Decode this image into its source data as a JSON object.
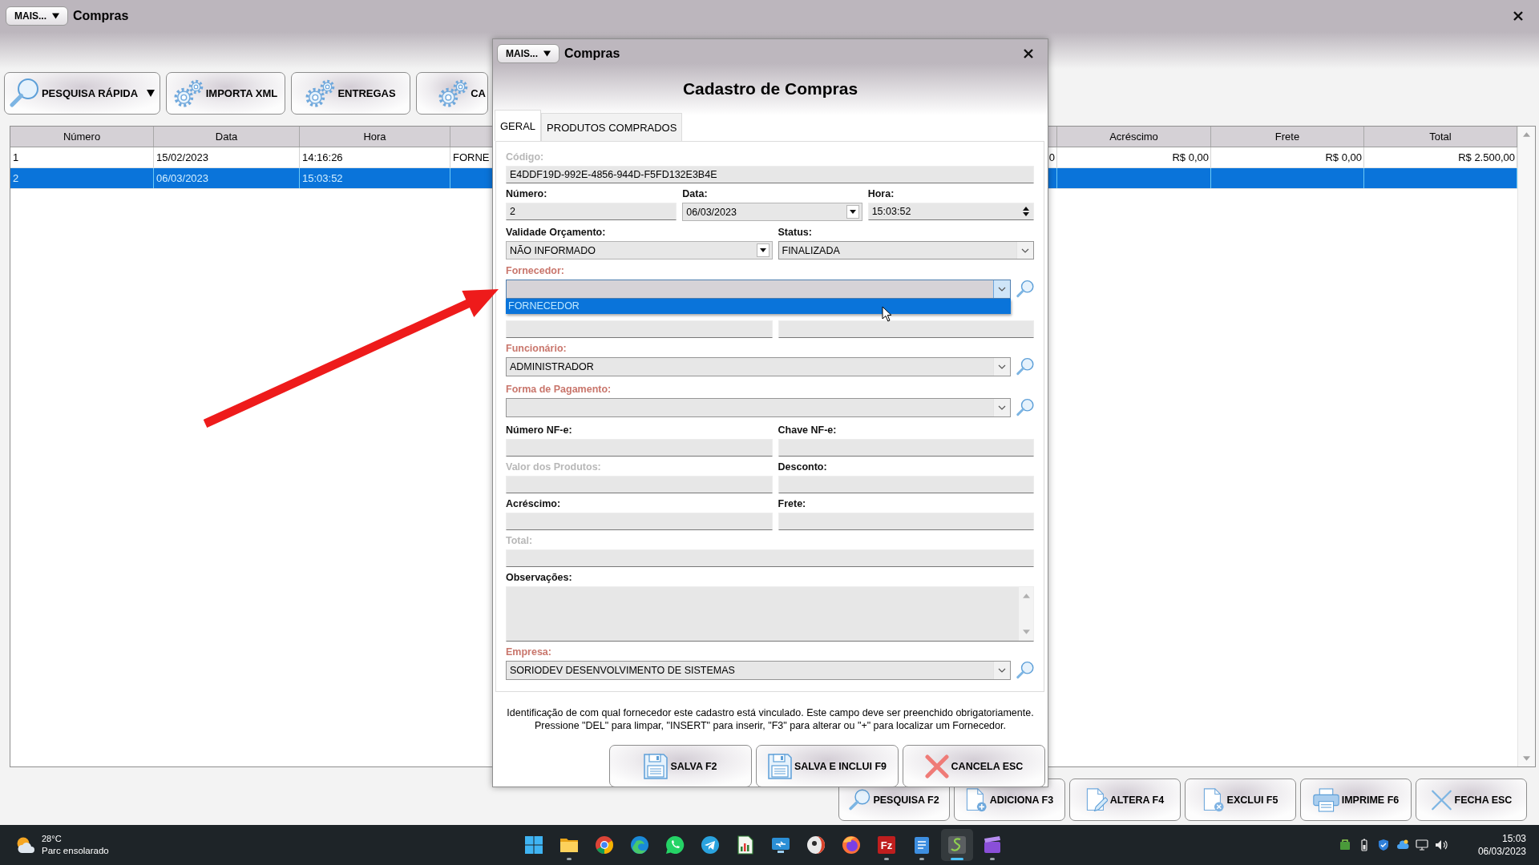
{
  "window": {
    "menu_button": "MAIS...",
    "title": "Compras"
  },
  "toolbar": [
    {
      "label": "PESQUISA RÁPIDA",
      "kind": "search",
      "dropdown": true
    },
    {
      "label": "IMPORTA XML",
      "kind": "gears",
      "dropdown": false
    },
    {
      "label": "ENTREGAS",
      "kind": "gears",
      "dropdown": false
    },
    {
      "label": "CA",
      "kind": "gears",
      "dropdown": false
    }
  ],
  "table": {
    "columns": [
      "Número",
      "Data",
      "Hora",
      "Acréscimo",
      "Frete",
      "Total"
    ],
    "rows": [
      {
        "selected": false,
        "cells": [
          "1",
          "15/02/2023",
          "14:16:26",
          "FORNE",
          "0",
          "R$ 0,00",
          "R$ 0,00",
          "R$ 2.500,00"
        ]
      },
      {
        "selected": true,
        "cells": [
          "2",
          "06/03/2023",
          "15:03:52"
        ]
      }
    ]
  },
  "dialog": {
    "menu_button": "MAIS...",
    "title": "Compras",
    "heading": "Cadastro de Compras",
    "tabs": [
      {
        "label": "GERAL",
        "selected": true
      },
      {
        "label": "PRODUTOS COMPRADOS",
        "selected": false
      }
    ],
    "form": [
      {
        "fields": [
          {
            "kind": "text",
            "label": "Código:",
            "value": "E4DDF19D-992E-4856-944D-F5FD132E3B4E",
            "required": false,
            "disabled": true
          }
        ]
      },
      {
        "fields": [
          {
            "kind": "text",
            "label": "Número:",
            "value": "2",
            "required": false,
            "disabled": false
          },
          {
            "kind": "picker",
            "label": "Data:",
            "value": "06/03/2023",
            "required": false,
            "disabled": false
          },
          {
            "kind": "spin",
            "label": "Hora:",
            "value": "15:03:52",
            "required": false,
            "disabled": false
          }
        ]
      },
      {
        "fields": [
          {
            "kind": "picker",
            "label": "Validade Orçamento:",
            "value": "NÃO INFORMADO",
            "required": false,
            "disabled": false
          },
          {
            "kind": "combo",
            "label": "Status:",
            "value": "FINALIZADA",
            "required": false,
            "disabled": false,
            "search": false,
            "open": false
          }
        ]
      },
      {
        "fields": [
          {
            "kind": "combo",
            "label": "Fornecedor:",
            "required": true,
            "disabled": false,
            "search": true,
            "open": true,
            "options": [
              {
                "label": "FORNECEDOR",
                "selected": true
              }
            ]
          }
        ]
      },
      {
        "fields": [
          {
            "kind": "text"
          },
          {
            "kind": "text"
          }
        ]
      },
      {
        "fields": [
          {
            "kind": "combo",
            "label": "Funcionário:",
            "value": "ADMINISTRADOR",
            "required": true,
            "disabled": false,
            "search": true,
            "open": false
          }
        ]
      },
      {
        "fields": [
          {
            "kind": "combo",
            "label": "Forma de Pagamento:",
            "required": true,
            "disabled": false,
            "search": true,
            "open": false
          }
        ]
      },
      {
        "fields": [
          {
            "kind": "text",
            "label": "Número NF-e:",
            "required": false,
            "disabled": false
          },
          {
            "kind": "text",
            "label": "Chave NF-e:",
            "required": false,
            "disabled": false
          }
        ]
      },
      {
        "fields": [
          {
            "kind": "text",
            "label": "Valor dos Produtos:",
            "required": false,
            "disabled": true
          },
          {
            "kind": "text",
            "label": "Desconto:",
            "required": false,
            "disabled": false
          }
        ]
      },
      {
        "fields": [
          {
            "kind": "text",
            "label": "Acréscimo:",
            "required": false,
            "disabled": false
          },
          {
            "kind": "text",
            "label": "Frete:",
            "required": false,
            "disabled": false
          }
        ]
      },
      {
        "fields": [
          {
            "kind": "text",
            "label": "Total:",
            "required": false,
            "disabled": true
          }
        ]
      },
      {
        "fields": [
          {
            "kind": "textarea",
            "label": "Observações:",
            "required": false,
            "disabled": false
          }
        ]
      },
      {
        "fields": [
          {
            "kind": "combo",
            "label": "Empresa:",
            "value": "SORIODEV DESENVOLVIMENTO DE SISTEMAS",
            "required": true,
            "disabled": false,
            "search": true,
            "open": false
          }
        ]
      }
    ],
    "help_text": [
      "Identificação de com qual fornecedor este cadastro está vinculado. Este campo deve ser preenchido obrigatoriamente.",
      "Pressione \"DEL\" para limpar, \"INSERT\" para inserir, \"F3\" para alterar ou \"+\" para localizar um Fornecedor."
    ],
    "buttons": [
      {
        "label": "SALVA F2",
        "kind": "floppy"
      },
      {
        "label": "SALVA E INCLUI F9",
        "kind": "floppy"
      },
      {
        "label": "CANCELA ESC",
        "kind": "cross"
      }
    ]
  },
  "bottom_buttons": [
    {
      "label": "PESQUISA F2",
      "kind": "search"
    },
    {
      "label": "ADICIONA F3",
      "kind": "doc-plus"
    },
    {
      "label": "ALTERA F4",
      "kind": "doc-pencil"
    },
    {
      "label": "EXCLUI F5",
      "kind": "doc-x"
    },
    {
      "label": "IMPRIME F6",
      "kind": "printer"
    },
    {
      "label": "FECHA ESC",
      "kind": "close"
    }
  ],
  "taskbar": {
    "weather": {
      "temperature": "28°C",
      "condition": "Parc ensolarado"
    },
    "apps": [
      {
        "kind": "start",
        "open": false,
        "active": false
      },
      {
        "kind": "folder",
        "open": true,
        "active": false
      },
      {
        "kind": "wheel",
        "open": false,
        "active": false
      },
      {
        "kind": "swirl",
        "open": false,
        "active": false
      },
      {
        "kind": "chat",
        "open": false,
        "active": false
      },
      {
        "kind": "plane",
        "open": false,
        "active": false
      },
      {
        "kind": "sheet",
        "open": false,
        "active": false
      },
      {
        "kind": "screen",
        "open": false,
        "active": false
      },
      {
        "kind": "disc",
        "open": false,
        "active": false
      },
      {
        "kind": "globe",
        "open": false,
        "active": false
      },
      {
        "kind": "letter",
        "text": "Fz",
        "open": true,
        "active": false
      },
      {
        "kind": "notepad",
        "open": true,
        "active": false
      },
      {
        "kind": "wave",
        "open": true,
        "active": true
      },
      {
        "kind": "clapper",
        "open": true,
        "active": false
      }
    ],
    "clock": {
      "time": "15:03",
      "date": "06/03/2023"
    }
  }
}
